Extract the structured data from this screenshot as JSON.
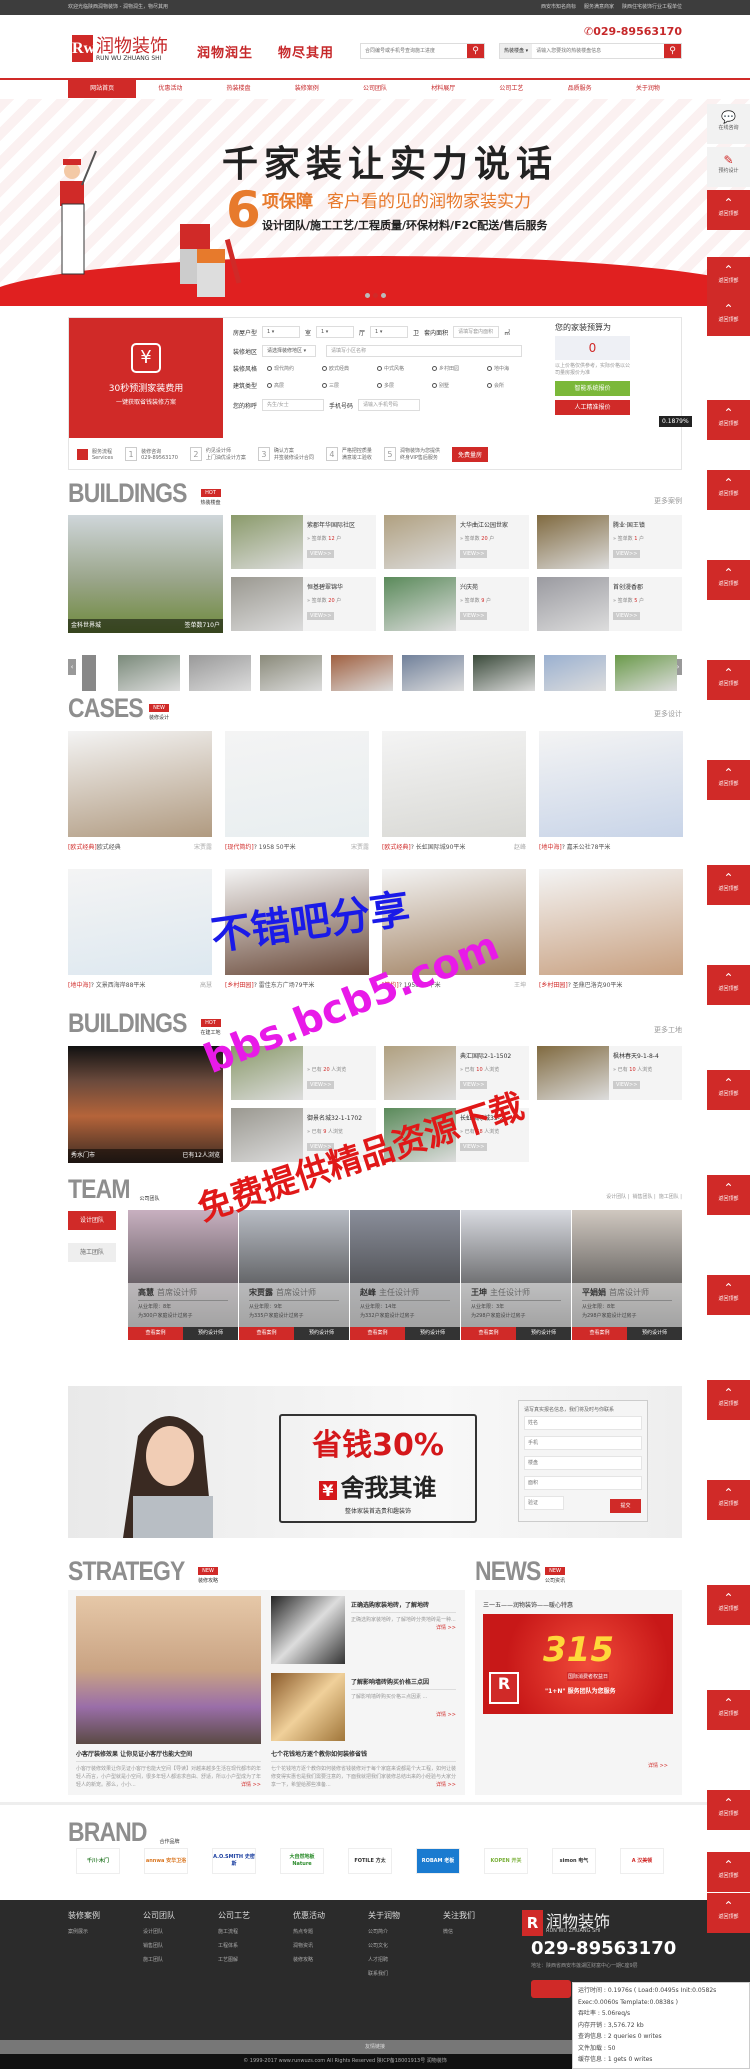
{
  "topbar": {
    "welcome": "欢迎光临陕西润物装饰 - 润物润生，物尽其用",
    "links": [
      "西安市知名商标",
      "服务满意商家",
      "陕西住宅装饰行业工程单位"
    ]
  },
  "header": {
    "logo_mark": "Rw",
    "logo_cn": "润物装饰",
    "logo_en": "RUN WU ZHUANG SHI",
    "slogan1": "润物润生",
    "slogan2": "物尽其用",
    "phone": "029-89563170",
    "progress_search_placeholder": "合同编号或手机号查询施工进度",
    "building_select": "热装楼盘 ▾",
    "building_search_placeholder": "请输入您要找的热装楼盘信息"
  },
  "nav": [
    "网站首页",
    "优惠活动",
    "热装楼盘",
    "装修案例",
    "公司团队",
    "材料展厅",
    "公司工艺",
    "品质服务",
    "关于润物"
  ],
  "banner": {
    "title": "千家装让实力说话",
    "number": "6",
    "guarantee": "项保障",
    "subtitle": "客户看的见的润物家装实力",
    "items": "设计团队/施工工艺/工程质量/环保材料/F2C配送/售后服务",
    "active_slide": 2,
    "slides": 3
  },
  "sidebar": {
    "consult": "在线咨询",
    "design": "预约设计",
    "top": "返回顶部"
  },
  "quote": {
    "panel_title": "30秒预测家装费用",
    "panel_sub": "一键获取省钱装修方案",
    "house_type_label": "房屋户型",
    "room_value": "1",
    "room": "室",
    "hall_value": "1",
    "hall": "厅",
    "bath_value": "1",
    "bath": "卫",
    "area_label": "套内面积",
    "area_placeholder": "请填写套内面积",
    "area_unit": "㎡",
    "region_label": "装修地区",
    "region_select": "请选择装修地区",
    "community_placeholder": "请填写小区名称",
    "style_label": "装修风格",
    "styles": [
      "现代简约",
      "欧式经典",
      "中式风格",
      "乡村田园",
      "地中海"
    ],
    "building_label": "建筑类型",
    "buildings": [
      "高层",
      "三层",
      "多层",
      "别墅",
      "会所"
    ],
    "name_label": "您的称呼",
    "name_placeholder": "先生/女士",
    "phone_label": "手机号码",
    "phone_placeholder": "请输入手机号码",
    "budget_title": "您的家装预算为",
    "budget_value": "0",
    "budget_note": "以上价格仅供参考，实际价格以公司量房报价为准",
    "smart_btn": "智能系统报价",
    "manual_btn": "人工精准报价",
    "percent_badge": "0.1879%"
  },
  "services": {
    "title": "服务流程",
    "subtitle": "Services",
    "steps": [
      {
        "n": "1",
        "a": "装修咨询",
        "b": "029-89563170"
      },
      {
        "n": "2",
        "a": "约见设计师",
        "b": "上门油优设计方案"
      },
      {
        "n": "3",
        "a": "确认方案",
        "b": "并签装修设计合同"
      },
      {
        "n": "4",
        "a": "严格把控质量",
        "b": "满意竣工验收"
      },
      {
        "n": "5",
        "a": "润物装饰为您提供",
        "b": "终身VIP售后服务"
      }
    ],
    "free_btn": "免费量房"
  },
  "hot_buildings": {
    "title": "BUILDINGS",
    "badge": "HOT",
    "subtitle": "热装楼盘",
    "more": "更多案例",
    "feature": {
      "name": "金科世界城",
      "count": "签单数710户"
    },
    "cards": [
      {
        "name": "紫郡年华国际社区",
        "pre": "签单数",
        "count": "12",
        "unit": "户"
      },
      {
        "name": "大华曲江公园世家",
        "pre": "签单数",
        "count": "20",
        "unit": "户"
      },
      {
        "name": "腾业·国王镇",
        "pre": "签单数",
        "count": "1",
        "unit": "户"
      },
      {
        "name": "恒基碧翠锦华",
        "pre": "签单数",
        "count": "20",
        "unit": "户"
      },
      {
        "name": "兴庆苑",
        "pre": "签单数",
        "count": "9",
        "unit": "户"
      },
      {
        "name": "首创漫香郡",
        "pre": "签单数",
        "count": "5",
        "unit": "户"
      }
    ],
    "view": "VIEW>>",
    "prev": "‹",
    "next": "›"
  },
  "cases": {
    "title": "CASES",
    "badge": "NEW",
    "subtitle": "装修设计",
    "more": "更多设计",
    "items": [
      {
        "style": "[欧式经典]",
        "name": "欧式经典",
        "designer": "宋贾露"
      },
      {
        "style": "[现代简约]",
        "name": "? 1958 50平米",
        "designer": "宋贾露"
      },
      {
        "style": "[欧式经典]",
        "name": "? 长虹国际城90平米",
        "designer": "赵峰"
      },
      {
        "style": "[地中海]",
        "name": "? 嘉禾公社78平米",
        "designer": ""
      },
      {
        "style": "[地中海]",
        "name": "? 文景西海岸88平米",
        "designer": "高慧"
      },
      {
        "style": "[乡村田园]",
        "name": "? 雷佳东方广场79平米",
        "designer": ""
      },
      {
        "style": "[简约]",
        "name": "? 1958 66平米",
        "designer": "王坤"
      },
      {
        "style": "[乡村田园]",
        "name": "? 圣鼎巴洛克90平米",
        "designer": ""
      }
    ]
  },
  "sites": {
    "title": "BUILDINGS",
    "badge": "HOT",
    "subtitle": "在建工地",
    "more": "更多工地",
    "feature": {
      "name": "秀水门市",
      "count": "已有12人浏览"
    },
    "cards": [
      {
        "name": "",
        "pre": "已有",
        "count": "20",
        "unit": "人浏览"
      },
      {
        "name": "典汇国际2-1-1502",
        "pre": "已有",
        "count": "10",
        "unit": "人浏览"
      },
      {
        "name": "枫林春天9-1-8-4",
        "pre": "已有",
        "count": "10",
        "unit": "人浏览"
      },
      {
        "name": "御景名城32-1-1702",
        "pre": "已有",
        "count": "9",
        "unit": "人浏览"
      },
      {
        "name": "长虹国际城33-2-",
        "pre": "已有",
        "count": "58",
        "unit": "人浏览"
      }
    ],
    "view": "VIEW>>"
  },
  "team": {
    "title": "TEAM",
    "subtitle": "公司团队",
    "links": [
      "设计团队 |",
      "销售团队 |",
      "施工团队 |"
    ],
    "tabs": [
      "设计团队",
      "施工团队"
    ],
    "members": [
      {
        "name": "高慧",
        "role": "首席设计师",
        "years": "从业年限：8年",
        "cases": "为300户家庭设计过房子"
      },
      {
        "name": "宋贾露",
        "role": "首席设计师",
        "years": "从业年限：9年",
        "cases": "为335户家庭设计过房子"
      },
      {
        "name": "赵峰",
        "role": "主任设计师",
        "years": "从业年限：14年",
        "cases": "为332户家庭设计过房子"
      },
      {
        "name": "王坤",
        "role": "主任设计师",
        "years": "从业年限：3年",
        "cases": "为298户家庭设计过房子"
      },
      {
        "name": "平娟娟",
        "role": "首席设计师",
        "years": "从业年限：8年",
        "cases": "为298户家庭设计过房子"
      }
    ],
    "view_btn": "查看案例",
    "book_btn": "预约设计师"
  },
  "promo": {
    "save": "省钱30%",
    "slogan": "舍我其谁",
    "sub": "整体家装首选贵和趣装饰",
    "form_title": "请写真实报名信息，我们将及时与你联系",
    "fields": [
      "姓名",
      "手机",
      "楼盘",
      "面积",
      "验证"
    ],
    "submit": "提交"
  },
  "strategy": {
    "title": "STRATEGY",
    "badge": "NEW",
    "subtitle": "装修攻略",
    "side": [
      {
        "t": "正确选购家装地砖，了解地砖",
        "d": "正确选购家装地砖，了解地砖分类地砖是一种..."
      },
      {
        "t": "了解影响墙砖购买价格三点因",
        "d": "了解影响墙砖购买价格三点因素 ..."
      }
    ],
    "main": [
      {
        "t": "小客厅装修效果 让你见证小客厅也能大空间",
        "d": "小客厅装修效果让你见证小客厅也能大空间【导读】对越来越多生活在现代都市的年轻人而言，小户型就是小空间，很多年轻人都追求自由、舒适，所以小户型成为了年轻人的新宠。那么，小小..."
      },
      {
        "t": "七个花钱地方逐个教你如何装修省钱",
        "d": "七个花钱地方逐个教你如何装修省钱装修对于每个家庭来说都是个大工程，如何让装修变得实惠也是我们需要注意的，下面我就把我们家装修总结出来的小经验与大家分享一下，希望给那些准备..."
      }
    ],
    "detail": "详情 >>"
  },
  "news": {
    "title": "NEWS",
    "badge": "NEW",
    "subtitle": "公司资讯",
    "headline": "三一五——润物装饰——暖心特惠",
    "image_text": "315",
    "image_sub": "国际消费者权益日",
    "image_caption": "\"1+N\" 服务团队为您服务",
    "detail": "详情 >>"
  },
  "brand": {
    "title": "BRAND",
    "subtitle": "合作品牌",
    "logos": [
      {
        "n": "千川·木门",
        "c": "#2a7a2a",
        "bg": "#fff"
      },
      {
        "n": "annwa 安华卫浴",
        "c": "#d9751f",
        "bg": "#fff"
      },
      {
        "n": "A.O.SMITH 史密斯",
        "c": "#1b3fa0",
        "bg": "#fff"
      },
      {
        "n": "大自然地板 Nature",
        "c": "#2c8c2c",
        "bg": "#fff"
      },
      {
        "n": "FOTILE 方太",
        "c": "#333",
        "bg": "#fff"
      },
      {
        "n": "ROBAM 老板",
        "c": "#fff",
        "bg": "#1a7bd0"
      },
      {
        "n": "KOPEN 开关",
        "c": "#7ab03a",
        "bg": "#fff"
      },
      {
        "n": "simon 电气",
        "c": "#333",
        "bg": "#fff"
      },
      {
        "n": "A 汉美顿",
        "c": "#d02a28",
        "bg": "#fff"
      }
    ]
  },
  "footer": {
    "cols": [
      {
        "h": "装修案例",
        "l": [
          "案例展示"
        ]
      },
      {
        "h": "公司团队",
        "l": [
          "设计团队",
          "销售团队",
          "施工团队"
        ]
      },
      {
        "h": "公司工艺",
        "l": [
          "施工流程",
          "工程体系",
          "工艺图解"
        ]
      },
      {
        "h": "优惠活动",
        "l": [
          "热点专题",
          "润物资讯",
          "装修攻略"
        ]
      },
      {
        "h": "关于润物",
        "l": [
          "公司简介",
          "公司文化",
          "人才招聘",
          "联系我们"
        ]
      },
      {
        "h": "关注我们",
        "l": [
          "微信"
        ]
      }
    ],
    "logo_cn": "润物装饰",
    "logo_en": "RUN WU ZHUANG SHI",
    "phone": "029-89563170",
    "address": "地址：陕西省西安市莲湖区财富中心一期C座9层",
    "links_bar": "友情链接",
    "copyright": "© 1999-2017 www.runwuzs.com All Rights Reserved 陕ICP备18001913号 润物装饰"
  },
  "debug": [
    "运行时间 : 0.1976s ( Load:0.0495s Init:0.0582s",
    "Exec:0.0060s Template:0.0838s )",
    "吞吐率 : 5.06req/s",
    "内存开销 : 3,576.72 kb",
    "查询信息 : 2 queries 0 writes",
    "文件加载 : 50",
    "缓存信息 : 1 gets 0 writes"
  ],
  "watermark": {
    "line1": "不错吧分享",
    "line2": "bbs.bcb5.com",
    "line3": "免费提供精品资源下载"
  },
  "colors": {
    "brand_red": "#d02a28",
    "dark": "#2b2b2b",
    "green": "#7bb83a"
  }
}
